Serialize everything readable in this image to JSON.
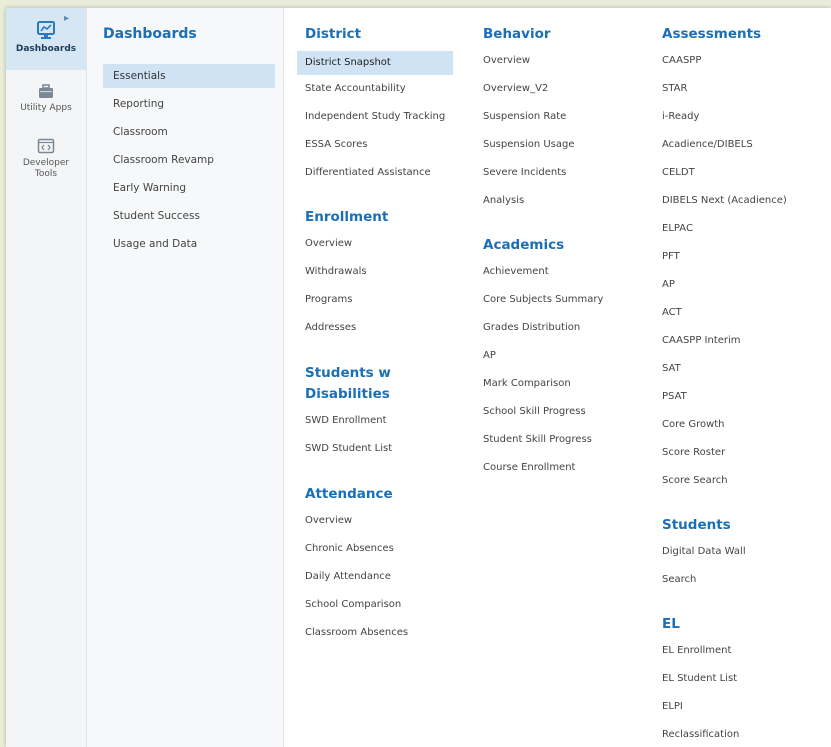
{
  "rail": {
    "items": [
      {
        "label": "Dashboards",
        "icon": "monitor-icon",
        "active": true
      },
      {
        "label": "Utility Apps",
        "icon": "apps-briefcase-icon",
        "active": false
      },
      {
        "label": "Developer Tools",
        "icon": "code-window-icon",
        "active": false
      }
    ]
  },
  "dashboards": {
    "title": "Dashboards",
    "items": [
      "Essentials",
      "Reporting",
      "Classroom",
      "Classroom Revamp",
      "Early Warning",
      "Student Success",
      "Usage and Data"
    ],
    "selected": "Essentials"
  },
  "district": {
    "title": "District",
    "links": [
      "District Snapshot",
      "State Accountability",
      "Independent Study Tracking",
      "ESSA Scores",
      "Differentiated Assistance"
    ],
    "selected": "District Snapshot"
  },
  "enrollment": {
    "title": "Enrollment",
    "links": [
      "Overview",
      "Withdrawals",
      "Programs",
      "Addresses"
    ]
  },
  "swd": {
    "title_line1": "Students w",
    "title_line2": "Disabilities",
    "links": [
      "SWD Enrollment",
      "SWD Student List"
    ]
  },
  "attendance": {
    "title": "Attendance",
    "links": [
      "Overview",
      "Chronic Absences",
      "Daily Attendance",
      "School Comparison",
      "Classroom Absences"
    ]
  },
  "behavior": {
    "title": "Behavior",
    "links": [
      "Overview",
      "Overview_V2",
      "Suspension Rate",
      "Suspension Usage",
      "Severe Incidents",
      "Analysis"
    ]
  },
  "academics": {
    "title": "Academics",
    "links": [
      "Achievement",
      "Core Subjects Summary",
      "Grades Distribution",
      "AP",
      "Mark Comparison",
      "School Skill Progress",
      "Student Skill Progress",
      "Course Enrollment"
    ]
  },
  "assessments": {
    "title": "Assessments",
    "links": [
      "CAASPP",
      "STAR",
      "i-Ready",
      "Acadience/DIBELS",
      "CELDT",
      "DIBELS Next (Acadience)",
      "ELPAC",
      "PFT",
      "AP",
      "ACT",
      "CAASPP Interim",
      "SAT",
      "PSAT",
      "Core Growth",
      "Score Roster",
      "Score Search"
    ]
  },
  "students": {
    "title": "Students",
    "links": [
      "Digital Data Wall",
      "Search"
    ]
  },
  "el": {
    "title": "EL",
    "links": [
      "EL Enrollment",
      "EL Student List",
      "ELPI",
      "Reclassification"
    ]
  },
  "colors": {
    "accent": "#1a6fb8",
    "highlight": "#cfe3f5"
  }
}
